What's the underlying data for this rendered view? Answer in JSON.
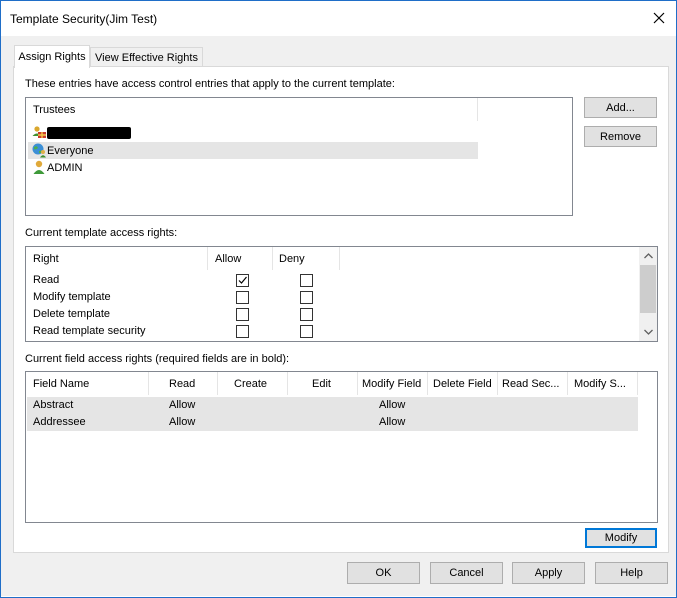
{
  "window": {
    "title": "Template Security(Jim Test)"
  },
  "tabs": [
    {
      "label": "Assign Rights",
      "active": true
    },
    {
      "label": "View Effective Rights",
      "active": false
    }
  ],
  "trustees": {
    "caption": "These entries have access control entries that apply to the current template:",
    "column": "Trustees",
    "items": [
      {
        "name": "",
        "icon": "group-icon",
        "redacted": true
      },
      {
        "name": "Everyone",
        "icon": "globe-users-icon",
        "selected": true
      },
      {
        "name": "ADMIN",
        "icon": "user-icon"
      }
    ],
    "add_button": "Add...",
    "remove_button": "Remove"
  },
  "template_rights": {
    "caption": "Current template access rights:",
    "columns": [
      "Right",
      "Allow",
      "Deny"
    ],
    "rows": [
      {
        "right": "Read",
        "allow": true,
        "deny": false
      },
      {
        "right": "Modify template",
        "allow": false,
        "deny": false
      },
      {
        "right": "Delete template",
        "allow": false,
        "deny": false
      },
      {
        "right": "Read template security",
        "allow": false,
        "deny": false
      }
    ]
  },
  "field_rights": {
    "caption": "Current field access rights (required fields are in bold):",
    "columns": [
      "Field Name",
      "Read",
      "Create",
      "Edit",
      "Modify Field",
      "Delete Field",
      "Read Sec...",
      "Modify S..."
    ],
    "rows": [
      [
        "Abstract",
        "Allow",
        "",
        "",
        "Allow",
        "",
        "",
        ""
      ],
      [
        "Addressee",
        "Allow",
        "",
        "",
        "Allow",
        "",
        "",
        ""
      ]
    ],
    "modify_button": "Modify"
  },
  "footer": {
    "ok": "OK",
    "cancel": "Cancel",
    "apply": "Apply",
    "help": "Help"
  },
  "colors": {
    "accent": "#0078d7",
    "selection": "#e5e5e5",
    "check": "#000000"
  }
}
